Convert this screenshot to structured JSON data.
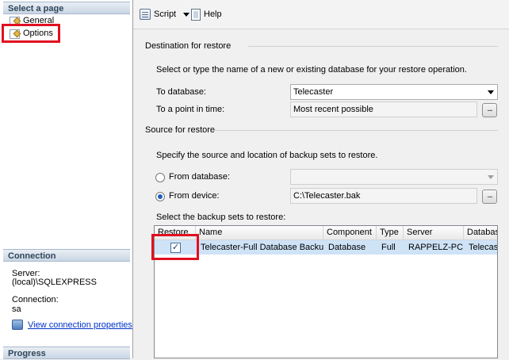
{
  "left_pane": {
    "select_page_header": "Select a page",
    "pages": [
      {
        "label": "General"
      },
      {
        "label": "Options"
      }
    ],
    "connection_header": "Connection",
    "server_label": "Server:",
    "server_value": "(local)\\SQLEXPRESS",
    "connection_label": "Connection:",
    "connection_value": "sa",
    "view_connection_link": "View connection properties",
    "progress_header": "Progress"
  },
  "toolbar": {
    "script_label": "Script",
    "help_label": "Help"
  },
  "destination": {
    "group_title": "Destination for restore",
    "description": "Select or type the name of a new or existing database for your restore operation.",
    "to_database_label": "To database:",
    "to_database_value": "Telecaster",
    "point_in_time_label": "To a point in time:",
    "point_in_time_value": "Most recent possible",
    "browse_label": "..."
  },
  "source": {
    "group_title": "Source for restore",
    "description": "Specify the source and location of backup sets to restore.",
    "from_database_label": "From database:",
    "from_database_value": "",
    "from_device_label": "From device:",
    "from_device_value": "C:\\Telecaster.bak",
    "browse_label": "...",
    "selected_option": "From device"
  },
  "backup_sets": {
    "label": "Select the backup sets to restore:",
    "columns": [
      "Restore",
      "Name",
      "Component",
      "Type",
      "Server",
      "Database"
    ],
    "rows": [
      {
        "restore": "✓",
        "name": "Telecaster-Full Database Backup",
        "component": "Database",
        "type": "Full",
        "server": "RAPPELZ-PC",
        "database": "Telecast"
      }
    ]
  },
  "colors": {
    "highlight_box": "#e01020",
    "selected_row": "#cfe3f7",
    "link": "#0033cc"
  }
}
